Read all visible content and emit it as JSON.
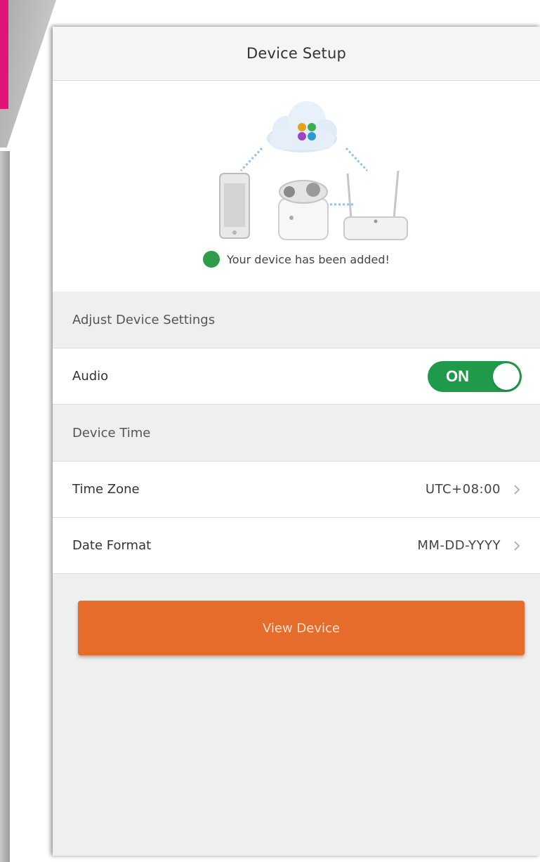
{
  "header": {
    "title": "Device Setup"
  },
  "hero": {
    "success_message": "Your device has been added!",
    "icons": [
      "cloud-icon",
      "phone-icon",
      "camera-icon",
      "router-icon",
      "check-circle-icon"
    ]
  },
  "sections": {
    "adjust_settings": {
      "title": "Adjust Device Settings"
    },
    "audio": {
      "label": "Audio",
      "toggle_state": "ON"
    },
    "device_time": {
      "title": "Device Time"
    },
    "time_zone": {
      "label": "Time Zone",
      "value": "UTC+08:00"
    },
    "date_format": {
      "label": "Date Format",
      "value": "MM-DD-YYYY"
    }
  },
  "actions": {
    "view_device": "View Device"
  },
  "colors": {
    "toggle_on": "#1f9a4b",
    "primary_button": "#e66c2c",
    "success_check": "#2e9c4a",
    "background": "#efeff0",
    "side_accent": "#e0157a"
  }
}
